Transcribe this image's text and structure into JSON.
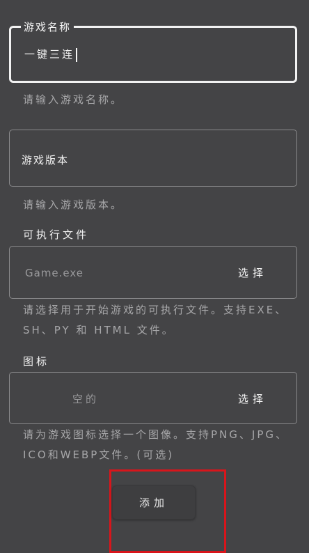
{
  "game_name": {
    "label": "游戏名称",
    "value": "一键三连",
    "helper": "请输入游戏名称。"
  },
  "game_version": {
    "value": "游戏版本",
    "helper": "请输入游戏版本。"
  },
  "executable": {
    "label": "可执行文件",
    "placeholder": "Game.exe",
    "select_label": "选择",
    "helper": "请选择用于开始游戏的可执行文件。支持EXE、SH、PY 和 HTML 文件。"
  },
  "icon": {
    "label": "图标",
    "placeholder": "空的",
    "select_label": "选择",
    "helper": "请为游戏图标选择一个图像。支持PNG、JPG、ICO和WEBP文件。(可选)"
  },
  "add_button": {
    "label": "添加"
  },
  "colors": {
    "background": "#444446",
    "highlight": "#d8151b"
  }
}
